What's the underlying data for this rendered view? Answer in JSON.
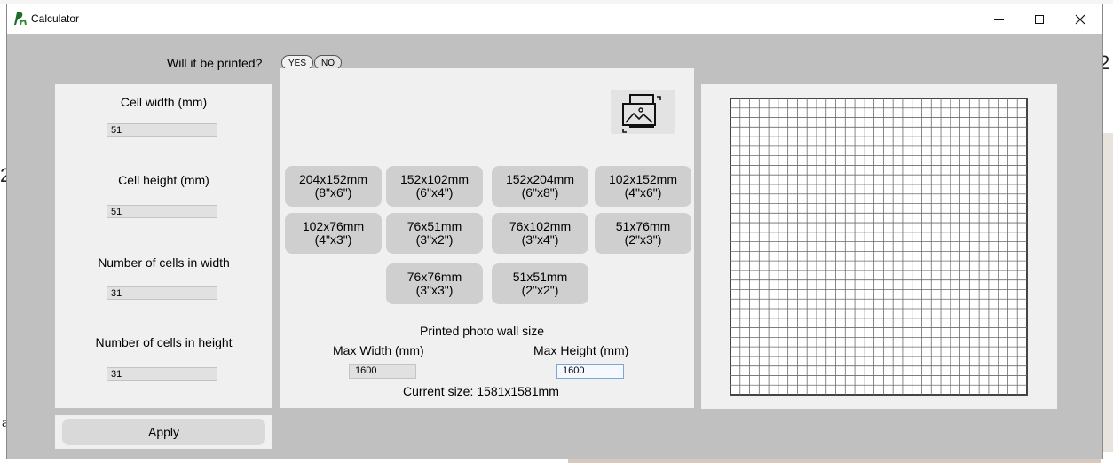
{
  "window": {
    "title": "Calculator",
    "controls": {
      "minimize": "—",
      "maximize": "☐",
      "close": "✕"
    }
  },
  "printed": {
    "question": "Will it be printed?",
    "yes_label": "YES",
    "no_label": "NO"
  },
  "fields": [
    {
      "label": "Cell width (mm)",
      "value": "51"
    },
    {
      "label": "Cell height (mm)",
      "value": "51"
    },
    {
      "label": "Number of cells in width",
      "value": "31"
    },
    {
      "label": "Number of cells in height",
      "value": "31"
    }
  ],
  "apply_label": "Apply",
  "sizes": [
    {
      "mm": "204x152mm",
      "inch": "(8\"x6\")"
    },
    {
      "mm": "152x102mm",
      "inch": "(6\"x4\")"
    },
    {
      "mm": "152x204mm",
      "inch": "(6\"x8\")"
    },
    {
      "mm": "102x152mm",
      "inch": "(4\"x6\")"
    },
    {
      "mm": "102x76mm",
      "inch": "(4\"x3\")"
    },
    {
      "mm": "76x51mm",
      "inch": "(3\"x2\")"
    },
    {
      "mm": "76x102mm",
      "inch": "(3\"x4\")"
    },
    {
      "mm": "51x76mm",
      "inch": "(2\"x3\")"
    },
    {
      "mm": "76x76mm",
      "inch": "(3\"x3\")"
    },
    {
      "mm": "51x51mm",
      "inch": "(2\"x2\")"
    }
  ],
  "wall": {
    "heading": "Printed photo wall size",
    "max_width_label": "Max Width (mm)",
    "max_width_value": "1600",
    "max_height_label": "Max Height (mm)",
    "max_height_value": "1600",
    "current_size": "Current size: 1581x1581mm"
  },
  "grid": {
    "columns": 31,
    "rows": 31
  },
  "icons": {
    "app": "app-logo-icon",
    "rotate": "rotate-orientation-icon"
  },
  "background_fragments": {
    "right_digit": "2",
    "left_digit": "2",
    "left_letter": "a"
  }
}
